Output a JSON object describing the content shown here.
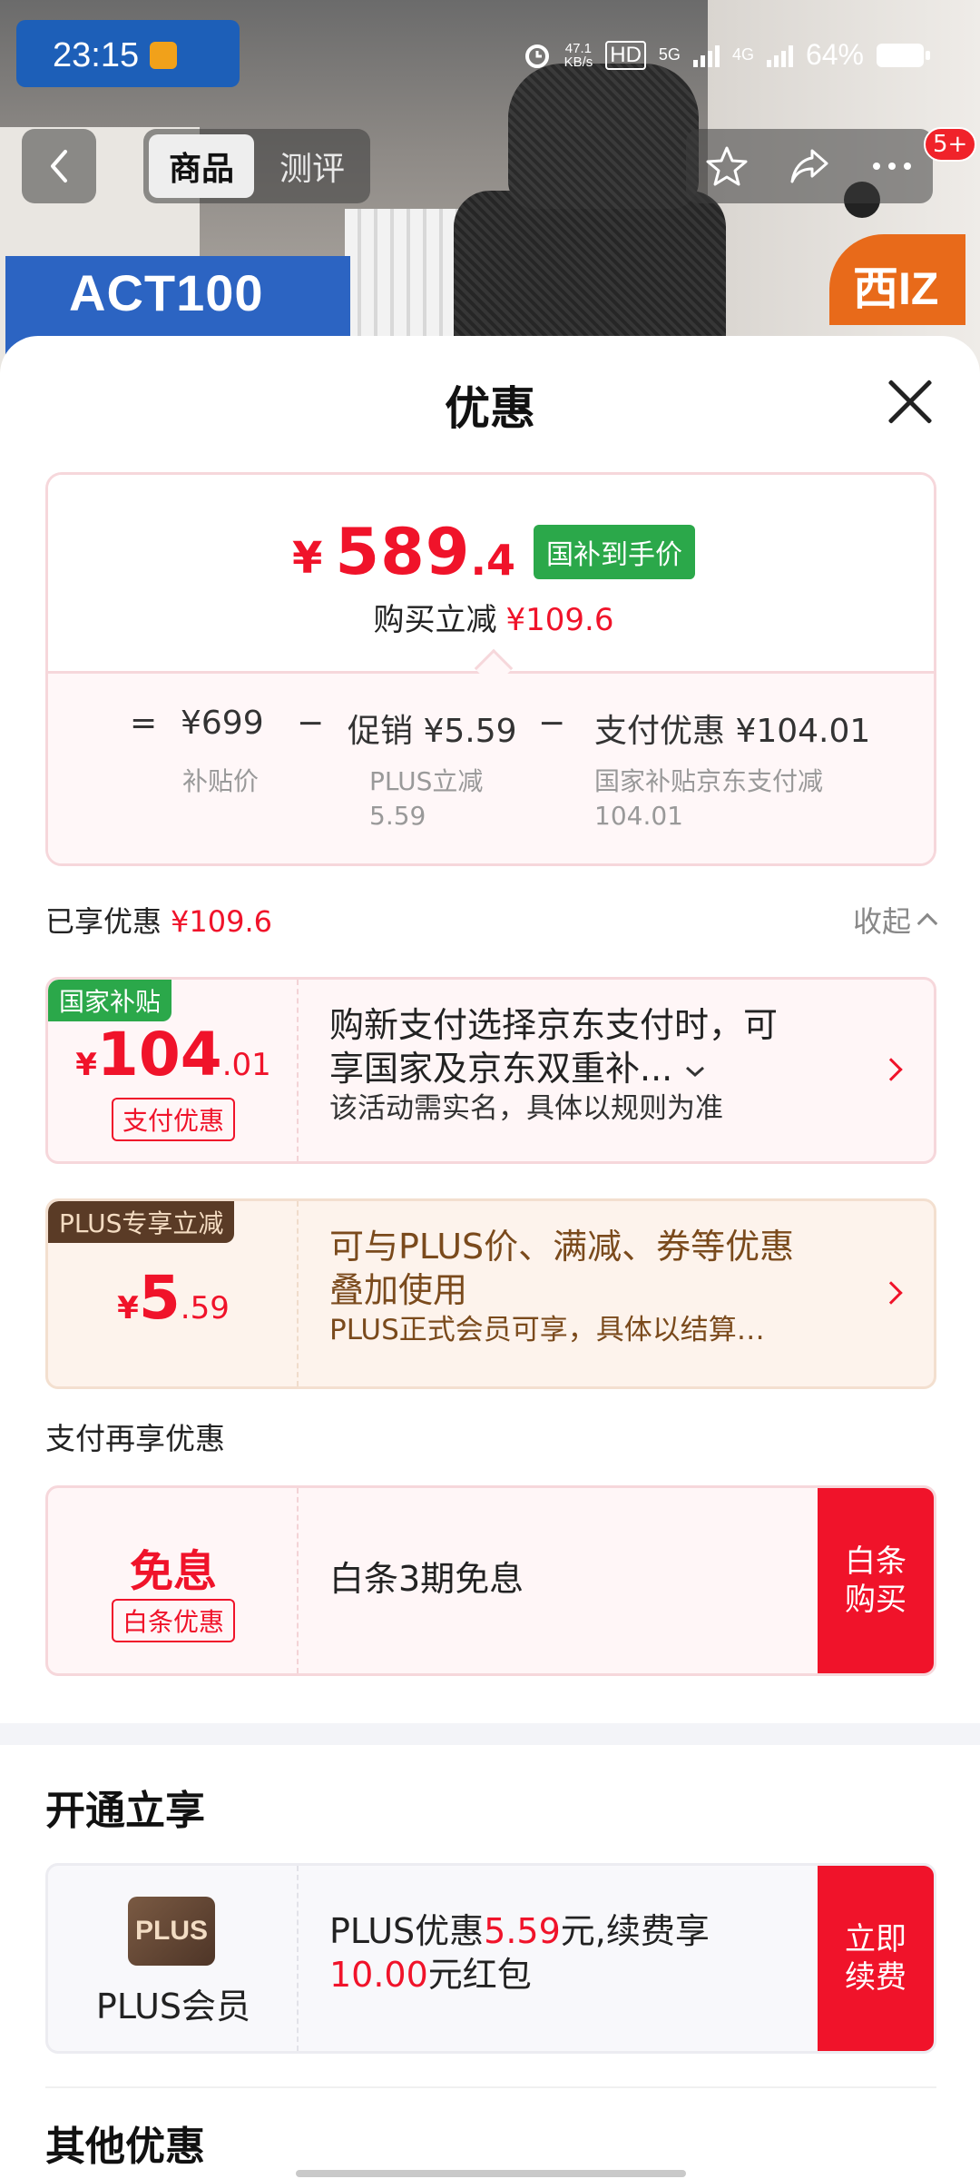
{
  "status": {
    "time": "23:15",
    "net_speed_top": "47.1",
    "net_speed_unit": "KB/s",
    "hd": "HD",
    "net1": "5G",
    "net2": "4G",
    "battery": "64%"
  },
  "nav": {
    "tabs": [
      {
        "label": "商品"
      },
      {
        "label": "测评"
      }
    ],
    "badge": "5+",
    "banner_text": "ACT100",
    "badge_text": "西IZ"
  },
  "sheet": {
    "title": "优惠",
    "price": {
      "currency": "¥",
      "integer": "589",
      "decimal": ".4",
      "tag": "国补到手价",
      "sub_label": "购买立减",
      "sub_amount": "¥109.6"
    },
    "calc": {
      "eq": "=",
      "base": "¥699",
      "minus1": "−",
      "promo": "促销 ¥5.59",
      "minus2": "−",
      "pay": "支付优惠 ¥104.01",
      "base_label": "补贴价",
      "promo_label_1": "PLUS立减",
      "promo_label_2": "5.59",
      "pay_label_1": "国家补贴京东支付减",
      "pay_label_2": "104.01"
    },
    "enjoyed": {
      "label": "已享优惠",
      "amount": "¥109.6",
      "collapse": "收起"
    },
    "coupon1": {
      "corner": "国家补贴",
      "y": "¥",
      "n": "104",
      "d": ".01",
      "tag": "支付优惠",
      "title_1": "购新支付选择京东支付时，可",
      "title_2": "享国家及京东双重补...",
      "desc": "该活动需实名，具体以规则为准"
    },
    "coupon2": {
      "corner": "PLUS专享立减",
      "y": "¥",
      "n": "5",
      "d": ".59",
      "title_1": "可与PLUS价、满减、券等优惠",
      "title_2": "叠加使用",
      "desc": "PLUS正式会员可享，具体以结算…"
    },
    "pay_more_label": "支付再享优惠",
    "coupon3": {
      "big": "免息",
      "tag": "白条优惠",
      "title": "白条3期免息",
      "button": "白条\n购买"
    },
    "open_section": "开通立享",
    "coupon4": {
      "logo": "PLUS",
      "name": "PLUS会员",
      "t1": "PLUS优惠",
      "t1_red": "5.59",
      "t1_end": "元,续费享",
      "t2_red": "10.00",
      "t2_end": "元红包",
      "button": "立即\n续费"
    },
    "other_section": "其他优惠"
  }
}
